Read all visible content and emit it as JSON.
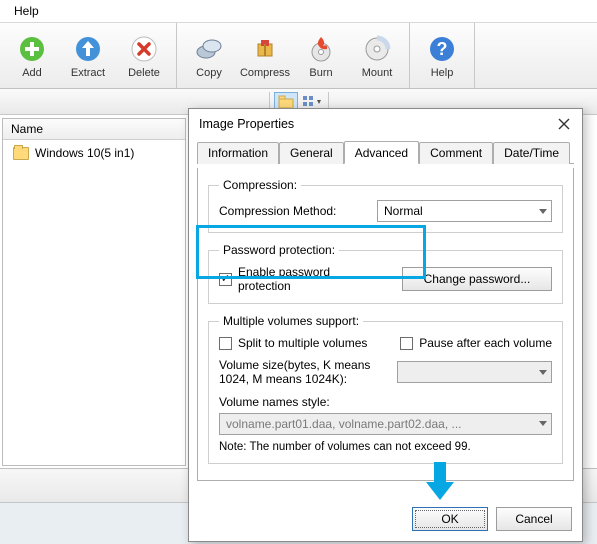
{
  "menu": {
    "items": [
      "Help"
    ]
  },
  "toolbar": {
    "groups": [
      [
        "Add",
        "Extract",
        "Delete"
      ],
      [
        "Copy",
        "Compress",
        "Burn",
        "Mount"
      ],
      [
        "Help"
      ]
    ]
  },
  "filepane": {
    "header": "Name",
    "items": [
      {
        "name": "Windows 10(5 in1)"
      }
    ]
  },
  "dialog": {
    "title": "Image Properties",
    "tabs": [
      "Information",
      "General",
      "Advanced",
      "Comment",
      "Date/Time"
    ],
    "active_tab": "Advanced",
    "compression": {
      "legend": "Compression:",
      "method_label": "Compression Method:",
      "method_value": "Normal"
    },
    "password": {
      "legend": "Password protection:",
      "enable_label": "Enable password protection",
      "enable_checked": true,
      "change_btn": "Change password..."
    },
    "volumes": {
      "legend": "Multiple volumes support:",
      "split_label": "Split to multiple volumes",
      "split_checked": false,
      "pause_label": "Pause after each volume",
      "pause_checked": false,
      "size_label": "Volume size(bytes, K means 1024, M means 1024K):",
      "size_value": "",
      "names_label": "Volume names style:",
      "names_value": "volname.part01.daa, volname.part02.daa, ...",
      "note": "Note: The number of volumes can not exceed 99."
    },
    "buttons": {
      "ok": "OK",
      "cancel": "Cancel"
    }
  }
}
